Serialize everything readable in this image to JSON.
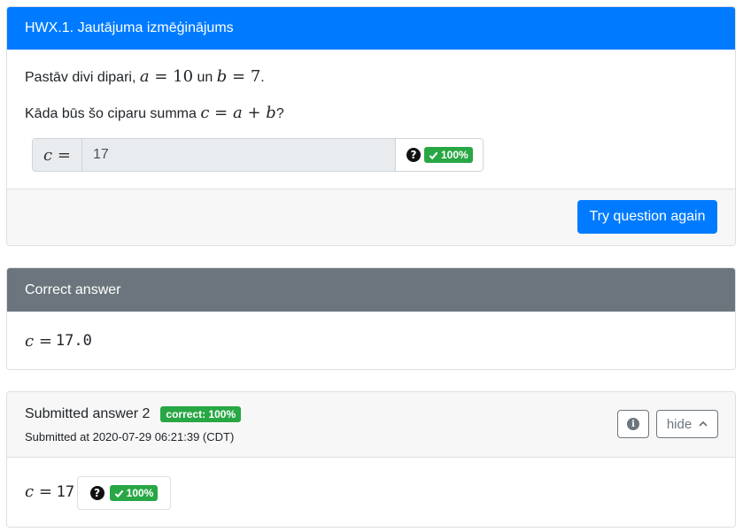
{
  "question": {
    "title": "HWX.1. Jautājuma izmēģinājums",
    "line1_prefix": "Pastāv divi dipari,",
    "line1_a_var": "a",
    "line1_a_val": "10",
    "line1_un": "un",
    "line1_b_var": "b",
    "line1_b_val": "7",
    "line2_prefix": "Kāda būs šo ciparu summa",
    "line2_c": "c",
    "line2_a": "a",
    "line2_b": "b",
    "input_label": "c =",
    "input_value": "17",
    "help_icon": "question-circle-icon",
    "score_badge": "100%",
    "try_again_label": "Try question again"
  },
  "correct_answer": {
    "title": "Correct answer",
    "var": "c",
    "value": "17.0"
  },
  "submission": {
    "title": "Submitted answer 2",
    "badge": "correct: 100%",
    "timestamp": "Submitted at 2020-07-29 06:21:39 (CDT)",
    "info_icon": "info-circle-icon",
    "hide_label": "hide",
    "var": "c",
    "value": "17",
    "score_badge": "100%"
  },
  "colors": {
    "primary": "#007bff",
    "secondary": "#6c757d",
    "success": "#28a745"
  }
}
